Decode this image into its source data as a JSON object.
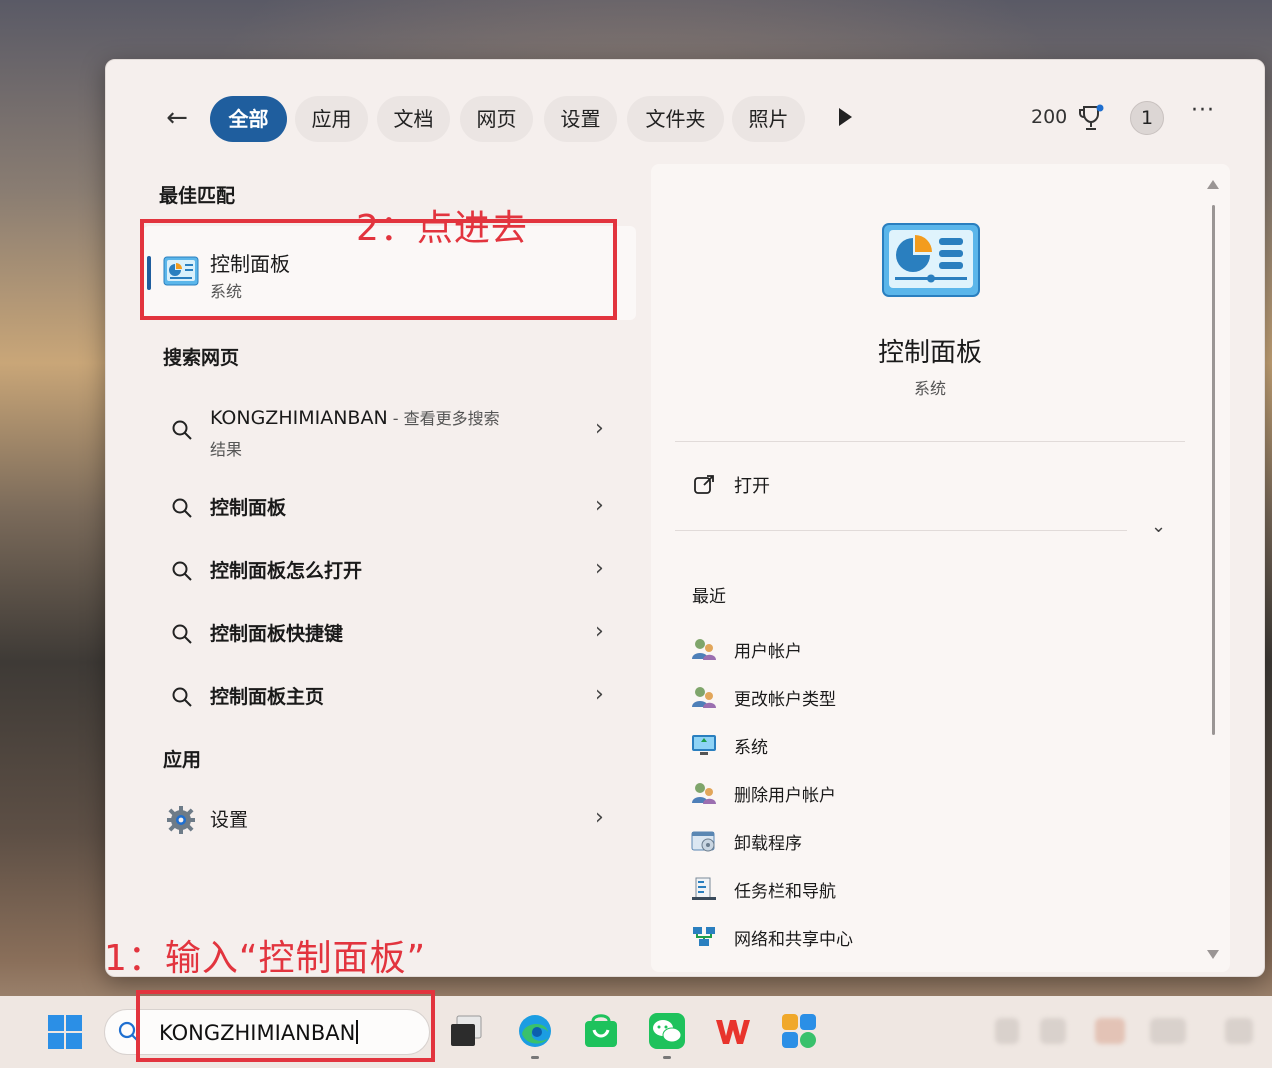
{
  "filters": {
    "back_label": "←",
    "chips": [
      "全部",
      "应用",
      "文档",
      "网页",
      "设置",
      "文件夹",
      "照片"
    ],
    "points": "200",
    "account_badge": "1",
    "more": "···"
  },
  "best_match": {
    "section": "最佳匹配",
    "title": "控制面板",
    "subtitle": "系统"
  },
  "web_search": {
    "section": "搜索网页",
    "first": {
      "query": "KONGZHIMIANBAN",
      "hint": " - 查看更多搜索",
      "hint2": "结果"
    },
    "items": [
      "控制面板",
      "控制面板怎么打开",
      "控制面板快捷键",
      "控制面板主页"
    ]
  },
  "apps": {
    "section": "应用",
    "items": [
      "设置"
    ]
  },
  "detail": {
    "title": "控制面板",
    "subtitle": "系统",
    "open_label": "打开",
    "recent_title": "最近",
    "recent": [
      "用户帐户",
      "更改帐户类型",
      "系统",
      "删除用户帐户",
      "卸载程序",
      "任务栏和导航",
      "网络和共享中心"
    ]
  },
  "annotations": {
    "step1": "1：输入“控制面板”",
    "step2": "2：点进去"
  },
  "taskbar": {
    "search_value": "KONGZHIMIANBAN"
  },
  "colors": {
    "accent": "#1f5e9e",
    "annotation_red": "#e2343e"
  }
}
